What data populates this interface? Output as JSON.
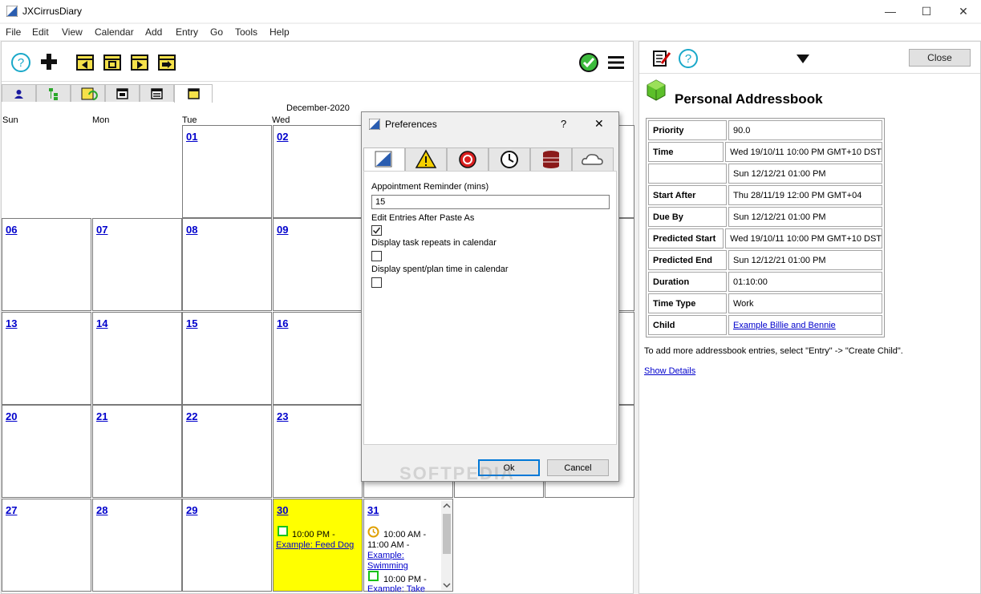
{
  "window": {
    "title": "JXCirrusDiary",
    "minimize": "—",
    "maximize": "☐",
    "close": "✕"
  },
  "menu": [
    "File",
    "Edit",
    "View",
    "Calendar",
    "Add",
    "Entry",
    "Go",
    "Tools",
    "Help"
  ],
  "calendar": {
    "month_label": "December-2020",
    "weekdays": [
      "Sun",
      "Mon",
      "Tue",
      "Wed"
    ],
    "days": {
      "d01": "01",
      "d02": "02",
      "d06": "06",
      "d07": "07",
      "d08": "08",
      "d09": "09",
      "d13": "13",
      "d14": "14",
      "d15": "15",
      "d16": "16",
      "d20": "20",
      "d21": "21",
      "d22": "22",
      "d23": "23",
      "d27": "27",
      "d28": "28",
      "d29": "29",
      "d30": "30",
      "d31": "31"
    },
    "highlight_color": "#ffff00",
    "events": {
      "e30_time": "10:00 PM -",
      "e30_link": "Example: Feed Dog",
      "e31_time1": "10:00 AM -",
      "e31_time1b": "11:00 AM -",
      "e31_link1a": "Example:",
      "e31_link1b": "Swimming",
      "e31_time2": "10:00 PM -",
      "e31_link2": "Example: Take"
    }
  },
  "right_panel": {
    "close_label": "Close",
    "title": "Personal Addressbook",
    "properties": [
      {
        "k": "Priority",
        "v": "90.0"
      },
      {
        "k": "Time",
        "v": "Wed 19/10/11 10:00 PM GMT+10 DST"
      },
      {
        "k": "",
        "v": "Sun 12/12/21 01:00 PM"
      },
      {
        "k": "Start After",
        "v": "Thu 28/11/19 12:00 PM GMT+04"
      },
      {
        "k": "Due By",
        "v": "Sun 12/12/21 01:00 PM"
      },
      {
        "k": "Predicted Start",
        "v": "Wed 19/10/11 10:00 PM GMT+10 DST"
      },
      {
        "k": "Predicted End",
        "v": "Sun 12/12/21 01:00 PM"
      },
      {
        "k": "Duration",
        "v": "01:10:00"
      },
      {
        "k": "Time Type",
        "v": "Work"
      },
      {
        "k": "Child",
        "v": "Example Billie and Bennie"
      }
    ],
    "hint": "To add more addressbook entries, select \"Entry\" -> \"Create Child\".",
    "show_details": "Show Details"
  },
  "dialog": {
    "title": "Preferences",
    "help": "?",
    "close": "✕",
    "reminder_label": "Appointment Reminder (mins)",
    "reminder_value": "15",
    "edit_after_paste_label": "Edit Entries After Paste As",
    "edit_after_paste_checked": true,
    "task_repeats_label": "Display task repeats in calendar",
    "task_repeats_checked": false,
    "spent_plan_label": "Display spent/plan time in calendar",
    "spent_plan_checked": false,
    "ok_label": "Ok",
    "cancel_label": "Cancel"
  },
  "watermark": "SOFTPEDIA",
  "icons": [
    "help-icon",
    "add-icon",
    "prev-icon",
    "today-icon",
    "next-icon",
    "jump-icon",
    "sync-ok-icon",
    "menu-icon",
    "edit-icon",
    "dropdown-icon",
    "addressbook-icon",
    "warning-icon",
    "no-entry-icon",
    "clock-icon",
    "database-icon",
    "cloud-icon",
    "checkbox-icon"
  ]
}
